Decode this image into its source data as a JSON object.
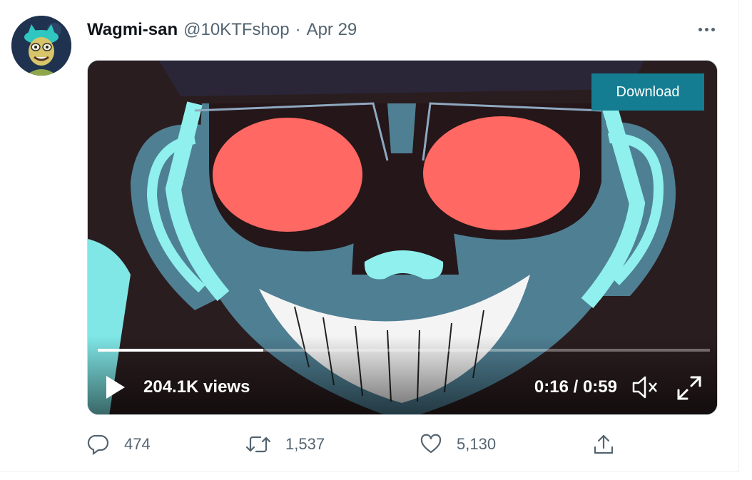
{
  "tweet": {
    "author_name": "Wagmi-san",
    "handle": "@10KTFshop",
    "separator": "·",
    "date": "Apr 29"
  },
  "video": {
    "download_label": "Download",
    "views": "204.1K views",
    "time": "0:16 / 0:59",
    "progress_fraction": 0.27
  },
  "actions": {
    "replies": "474",
    "retweets": "1,537",
    "likes": "5,130"
  },
  "icons": {
    "reply": "reply-icon",
    "retweet": "retweet-icon",
    "like": "heart-icon",
    "share": "share-icon",
    "more": "more-icon",
    "play": "play-icon",
    "volume": "volume-muted-icon",
    "fullscreen": "fullscreen-icon"
  },
  "colors": {
    "download_bg": "#147d92",
    "secondary_text": "#536471",
    "primary_text": "#0f1419"
  }
}
